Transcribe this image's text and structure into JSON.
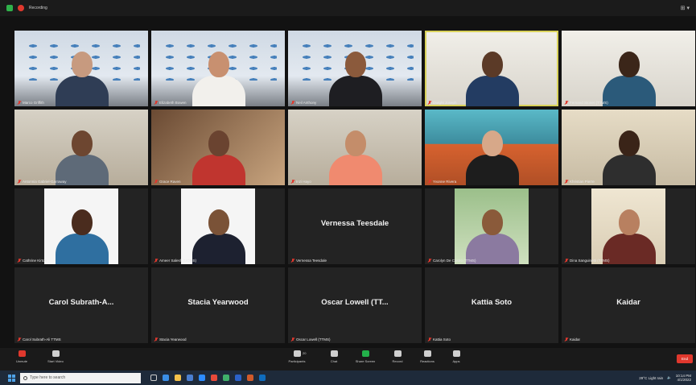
{
  "topbar": {
    "recording_label": "Recording",
    "view_label": "⊞ ▾"
  },
  "participants": [
    {
      "name": "Marco Griffith",
      "bg": "office",
      "skin": "#c79a7f",
      "shirt": "#2f3d55"
    },
    {
      "name": "Elizabeth Bowen",
      "bg": "office",
      "skin": "#c89070",
      "shirt": "#f2f0ec"
    },
    {
      "name": "Neil Anthony",
      "bg": "office",
      "skin": "#8b5a3c",
      "shirt": "#1e1e22"
    },
    {
      "name": "Dwight Joseph",
      "bg": "white",
      "skin": "#5b3a27",
      "shirt": "#233c62"
    },
    {
      "name": "Fernand Stoner (TTMS)",
      "bg": "white",
      "skin": "#3b2619",
      "shirt": "#2b5a7a"
    },
    {
      "name": "Antonnia Gabriel-Garraway",
      "bg": "room",
      "skin": "#6d4630",
      "shirt": "#5e6a78"
    },
    {
      "name": "Grace Raven",
      "bg": "wood",
      "skin": "#6a4330",
      "shirt": "#c0352f"
    },
    {
      "name": "Inzi Hayo",
      "bg": "room",
      "skin": "#c48d6a",
      "shirt": "#f08a6f"
    },
    {
      "name": "Yvonne Rivera",
      "bg": "teal",
      "skin": "#d7a889",
      "shirt": "#1d1d1d"
    },
    {
      "name": "Khristian Pierre",
      "bg": "beige",
      "skin": "#3a2418",
      "shirt": "#2e2e2e"
    },
    {
      "name": "Cathrine Kirton",
      "bg": "photo-white",
      "skin": "#4a2c1e",
      "shirt": "#2f6fa0"
    },
    {
      "name": "Ameer Salesh (UOMS)",
      "bg": "photo-white",
      "skin": "#7a5237",
      "shirt": "#1d2130"
    },
    {
      "name": "Vernessa Teesdale",
      "bg": "name",
      "label": "Vernessa Teesdale"
    },
    {
      "name": "Carolyn De Castro (TTMS)",
      "bg": "photo-green",
      "skin": "#8a5a3a",
      "shirt": "#8b7aa0"
    },
    {
      "name": "Dina Sanguinetti (TTMS)",
      "bg": "photo-beige",
      "skin": "#b88060",
      "shirt": "#6a2a25"
    },
    {
      "name": "Carol Subrath-Ali TTMS",
      "bg": "name",
      "label": "Carol Subrath-A..."
    },
    {
      "name": "Stacia Yearwood",
      "bg": "name",
      "label": "Stacia Yearwood"
    },
    {
      "name": "Oscar Lowell (TTMS)",
      "bg": "name",
      "label": "Oscar Lowell (TT..."
    },
    {
      "name": "Kattia Soto",
      "bg": "name",
      "label": "Kattia Soto"
    },
    {
      "name": "Kaidar",
      "bg": "name",
      "label": "Kaidar"
    }
  ],
  "controls": {
    "unmute": "Unmute",
    "start_video": "Start Video",
    "participants": "Participants",
    "participants_count": "20",
    "chat": "Chat",
    "share_screen": "Share Screen",
    "record": "Record",
    "reactions": "Reactions",
    "apps": "Apps",
    "end": "End"
  },
  "taskbar": {
    "search_placeholder": "Type here to search",
    "weather": "29°C  Light rain",
    "time": "10:14 PM",
    "date": "4/1/2022"
  }
}
